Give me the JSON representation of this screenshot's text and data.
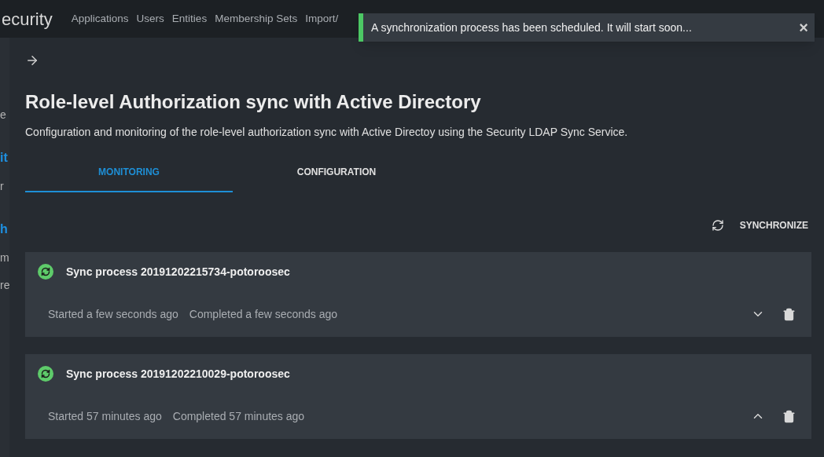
{
  "app_bar": {
    "brand": "ecurity",
    "nav": [
      {
        "label": "Applications",
        "selected": false
      },
      {
        "label": "Users",
        "selected": false
      },
      {
        "label": "Entities",
        "selected": false
      },
      {
        "label": "Membership Sets",
        "selected": false
      },
      {
        "label": "Import/",
        "selected": false
      }
    ]
  },
  "background_fragments": [
    {
      "text": "e",
      "kind": "plain"
    },
    {
      "text": "it",
      "kind": "link"
    },
    {
      "text": "r",
      "kind": "plain"
    },
    {
      "text": "h",
      "kind": "link"
    },
    {
      "text": "m",
      "kind": "plain"
    },
    {
      "text": "re",
      "kind": "plain"
    }
  ],
  "toast": {
    "message": "A synchronization process has been scheduled. It will start soon...",
    "close": "×"
  },
  "drawer": {
    "title": "Role-level Authorization sync with Active Directory",
    "description": "Configuration and monitoring of the role-level authorization sync with Active Directoy using the Security LDAP Sync Service.",
    "tabs": [
      {
        "label": "MONITORING",
        "selected": true
      },
      {
        "label": "CONFIGURATION",
        "selected": false
      }
    ],
    "synchronize_button": "SYNCHRONIZE",
    "processes": [
      {
        "name": "Sync process 20191202215734-potoroosec",
        "started": "Started a few seconds ago",
        "completed": "Completed a few seconds ago",
        "expanded": false
      },
      {
        "name": "Sync process 20191202210029-potoroosec",
        "started": "Started 57 minutes ago",
        "completed": "Completed 57 minutes ago",
        "expanded": true
      }
    ]
  }
}
